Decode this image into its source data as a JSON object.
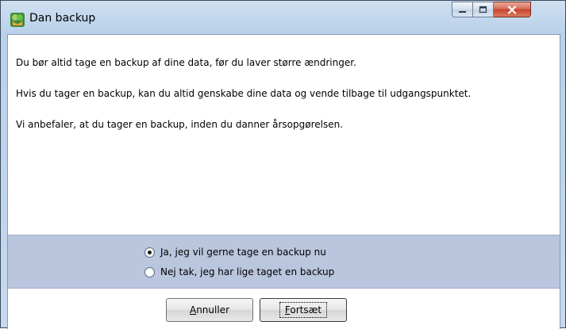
{
  "window": {
    "title": "Dan backup"
  },
  "message": {
    "line1": "Du bør altid tage en backup af dine data, før du laver større ændringer.",
    "line2": "Hvis du tager en backup, kan du altid genskabe dine data og vende tilbage til udgangspunktet.",
    "line3": "Vi anbefaler, at du tager en backup, inden du danner årsopgørelsen."
  },
  "options": {
    "yes_label": "Ja, jeg vil gerne tage en backup nu",
    "yes_selected": true,
    "no_label": "Nej tak, jeg har lige taget en backup",
    "no_selected": false
  },
  "buttons": {
    "cancel_accel": "A",
    "cancel_rest": "nnuller",
    "continue_accel": "F",
    "continue_rest": "ortsæt"
  },
  "colors": {
    "options_panel": "#bac6dd",
    "close_button": "#c7432b"
  }
}
